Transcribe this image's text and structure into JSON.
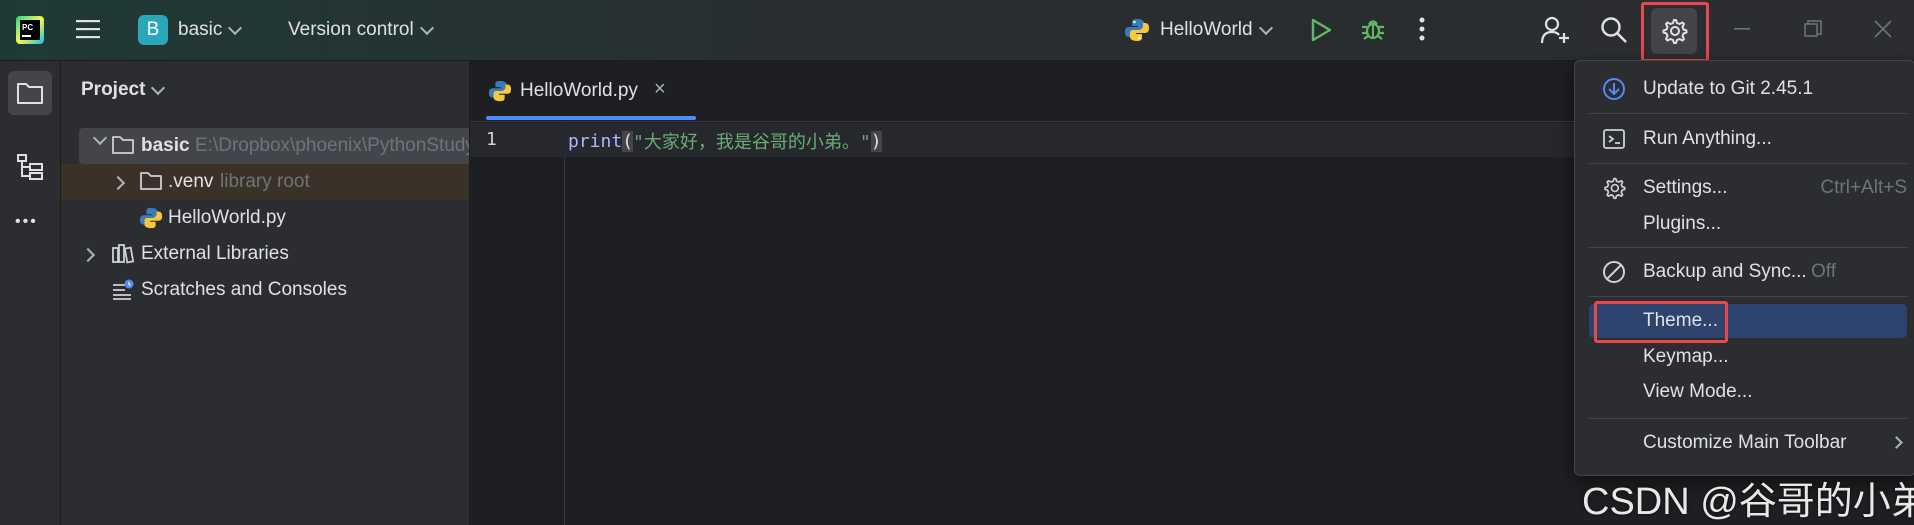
{
  "topbar": {
    "project_initial": "B",
    "project_name": "basic",
    "vcs_label": "Version control",
    "run_config": "HelloWorld"
  },
  "leftstrip": {
    "more": "•••"
  },
  "project_panel": {
    "title": "Project",
    "items": [
      {
        "label": "basic",
        "hint": "E:\\Dropbox\\phoenix\\PythonStudy"
      },
      {
        "label": ".venv",
        "hint": "library root"
      },
      {
        "label": "HelloWorld.py"
      },
      {
        "label": "External Libraries"
      },
      {
        "label": "Scratches and Consoles"
      }
    ]
  },
  "editor": {
    "tab_label": "HelloWorld.py",
    "tab_close": "×",
    "line_number": "1",
    "code_func": "print",
    "code_paren_open": "(",
    "code_string": "\"大家好，我是谷哥的小弟。\"",
    "code_paren_close": ")"
  },
  "menu": {
    "items": [
      {
        "label": "Update to Git 2.45.1"
      },
      {
        "label": "Run Anything..."
      },
      {
        "label": "Settings...",
        "shortcut": "Ctrl+Alt+S"
      },
      {
        "label": "Plugins..."
      },
      {
        "label": "Backup and Sync...",
        "suffix": "Off"
      },
      {
        "label": "Theme..."
      },
      {
        "label": "Keymap..."
      },
      {
        "label": "View Mode..."
      },
      {
        "label": "Customize Main Toolbar"
      }
    ]
  },
  "watermark": "CSDN @谷哥的小弟",
  "colors": {
    "accent_blue": "#548af7",
    "selection": "#2e436e",
    "highlight_red": "#e5484d",
    "run_green": "#5fb865",
    "string_green": "#6aab73",
    "keyword_purple": "#a9b7ff"
  }
}
